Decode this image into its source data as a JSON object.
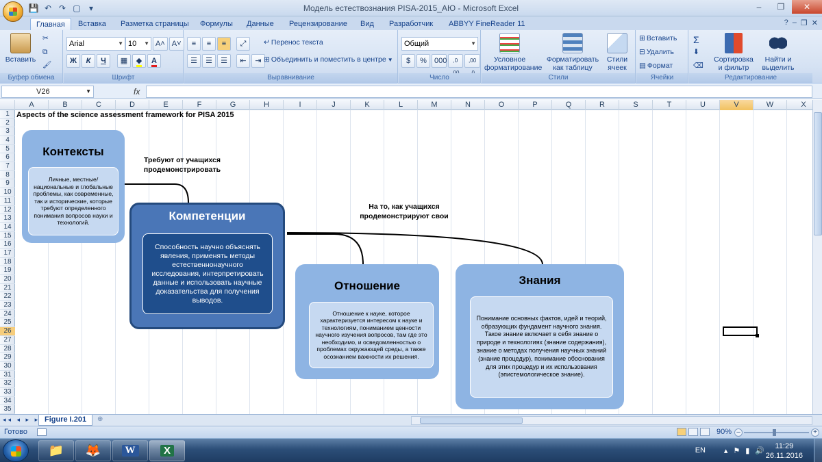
{
  "window": {
    "title": "Модель естествознания PISA-2015_АЮ - Microsoft Excel",
    "controls": [
      "–",
      "❐",
      "✕"
    ]
  },
  "quick_access": [
    "💾",
    "↶",
    "↷",
    "▢",
    "▾"
  ],
  "tabs": [
    "Главная",
    "Вставка",
    "Разметка страницы",
    "Формулы",
    "Данные",
    "Рецензирование",
    "Вид",
    "Разработчик",
    "ABBYY FineReader 11"
  ],
  "active_tab": "Главная",
  "tabs_right": [
    "?",
    "–",
    "❐",
    "✕"
  ],
  "ribbon": {
    "clipboard": {
      "title": "Буфер обмена",
      "paste": "Вставить"
    },
    "font": {
      "title": "Шрифт",
      "name": "Arial",
      "size": "10",
      "bold": "Ж",
      "italic": "К",
      "underline": "Ч",
      "grow": "A˄",
      "shrink": "A˅",
      "color_letter": "A"
    },
    "alignment": {
      "title": "Выравнивание",
      "wrap": "Перенос текста",
      "merge": "Объединить и поместить в центре"
    },
    "number": {
      "title": "Число",
      "format": "Общий",
      "currency": "$",
      "percent": "%",
      "thousands": "000",
      "inc_dec": ",0 ,00",
      "dec_dec": ",00 ,0"
    },
    "styles": {
      "title": "Стили",
      "conditional": "Условное форматирование",
      "as_table": "Форматировать как таблицу",
      "cell_styles": "Стили ячеек"
    },
    "cells": {
      "title": "Ячейки",
      "insert": "Вставить",
      "delete": "Удалить",
      "format": "Формат"
    },
    "editing": {
      "title": "Редактирование",
      "sum": "Σ",
      "sort": "Сортировка и фильтр",
      "find": "Найти и выделить"
    }
  },
  "formula_bar": {
    "name_box": "V26",
    "fx": "fx",
    "value": ""
  },
  "columns": [
    "A",
    "B",
    "C",
    "D",
    "E",
    "F",
    "G",
    "H",
    "I",
    "J",
    "K",
    "L",
    "M",
    "N",
    "O",
    "P",
    "Q",
    "R",
    "S",
    "T",
    "U",
    "V",
    "W",
    "X"
  ],
  "selected_column": "V",
  "rows": [
    "1",
    "2",
    "3",
    "4",
    "5",
    "6",
    "7",
    "8",
    "9",
    "10",
    "11",
    "12",
    "13",
    "14",
    "15",
    "16",
    "17",
    "18",
    "19",
    "20",
    "21",
    "22",
    "23",
    "24",
    "25",
    "26",
    "27",
    "28",
    "29",
    "30",
    "31",
    "32",
    "33",
    "34",
    "35"
  ],
  "selected_row": "26",
  "sheet": {
    "title": "Aspects of the science assessment framework for PISA 2015"
  },
  "diagram": {
    "contexts": {
      "heading": "Контексты",
      "body": "Личные, местные/национальные и глобальные проблемы, как современные, так и исторические, которые требуют определенного понимания вопросов науки и технологий."
    },
    "competencies": {
      "heading": "Компетенции",
      "body": "Способность научно объяснять явления, применять методы естественнонаучного исследования, интерпретировать данные и использовать научные доказательства для получения выводов."
    },
    "attitude": {
      "heading": "Отношение",
      "body": "Отношение к науке, которое характеризуется интересом к науке и технологиям, пониманием ценности научного изучения вопросов, там где это необходимо, и осведомленностью о проблемах окружающей среды, а также осознанием важности их решения."
    },
    "knowledge": {
      "heading": "Знания",
      "body": "Понимание основных фактов, идей и теорий, образующих фундамент научного знания. Такое знание включает в себя знание о природе и технологиях (знание содержания), знание о методах получения научных знаний (знание процедур), понимание обоснования для этих процедур и их использования (эпистемологическое знание)."
    },
    "note1": "Требуют от учащихся продемонстрировать",
    "note2": "На то, как учащихся продемонстрируют свои"
  },
  "sheet_tabs": {
    "active": "Figure I.201",
    "nav": "◂◂ ◂ ▸ ▸▸"
  },
  "status": {
    "ready": "Готово",
    "zoom": "90%"
  },
  "taskbar": {
    "apps": [
      "📁",
      "🦊",
      "W",
      "X"
    ],
    "lang": "EN",
    "time": "11:29",
    "date": "26.11.2016"
  }
}
